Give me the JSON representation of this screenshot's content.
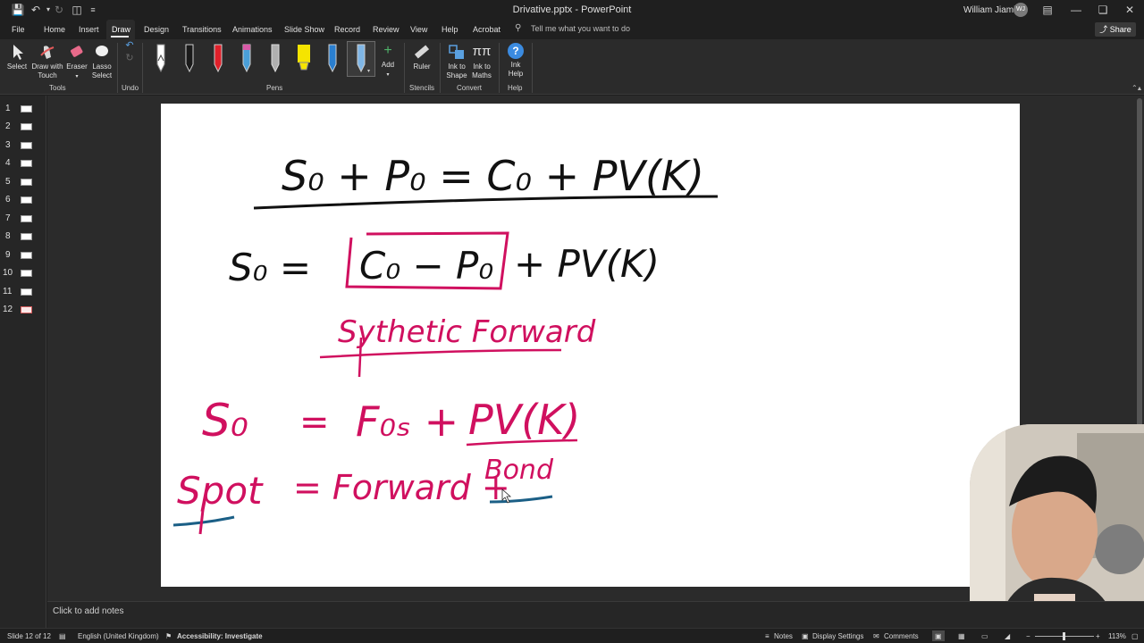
{
  "window": {
    "title": "Drivative.pptx - PowerPoint",
    "user_name": "William Jiamin",
    "user_initials": "WJ"
  },
  "ribbon_tabs": [
    {
      "label": "File"
    },
    {
      "label": "Home"
    },
    {
      "label": "Insert"
    },
    {
      "label": "Draw",
      "active": true
    },
    {
      "label": "Design"
    },
    {
      "label": "Transitions"
    },
    {
      "label": "Animations"
    },
    {
      "label": "Slide Show"
    },
    {
      "label": "Record"
    },
    {
      "label": "Review"
    },
    {
      "label": "View"
    },
    {
      "label": "Help"
    },
    {
      "label": "Acrobat"
    }
  ],
  "tell_me": "Tell me what you want to do",
  "share_label": "Share",
  "ribbon": {
    "tools": {
      "select": "Select",
      "draw_with_touch_1": "Draw with",
      "draw_with_touch_2": "Touch",
      "eraser": "Eraser",
      "lasso_1": "Lasso",
      "lasso_2": "Select",
      "group": "Tools"
    },
    "undo_group": "Undo",
    "pens_group": "Pens",
    "add_label": "Add",
    "ruler": "Ruler",
    "stencils_group": "Stencils",
    "ink_to_shape_1": "Ink to",
    "ink_to_shape_2": "Shape",
    "ink_to_maths_1": "Ink to",
    "ink_to_maths_2": "Maths",
    "convert_group": "Convert",
    "ink_help_1": "Ink",
    "ink_help_2": "Help",
    "help_group": "Help"
  },
  "pen_colors": [
    "#ffffff",
    "#1a1a1a",
    "#e0202a",
    "#4a9fd8",
    "#b0b0b0",
    "#f5e400",
    "#2a7fd0",
    "#7fb6e6"
  ],
  "slides": [
    {
      "num": "1"
    },
    {
      "num": "2"
    },
    {
      "num": "3"
    },
    {
      "num": "4"
    },
    {
      "num": "5"
    },
    {
      "num": "6"
    },
    {
      "num": "7"
    },
    {
      "num": "8"
    },
    {
      "num": "9"
    },
    {
      "num": "10"
    },
    {
      "num": "11"
    },
    {
      "num": "12",
      "selected": true
    }
  ],
  "ink": {
    "line1": "S₀ + P₀ = C₀ + PV(K)",
    "line2_left": "S₀ =",
    "line2_box": "C₀ − P₀",
    "line2_right": "+ PV(K)",
    "synthetic": "Sythetic Forward",
    "line3_left": "S₀",
    "line3_eq": "=",
    "line3_mid": "F₀ₛ +",
    "line3_right": "PV(K)",
    "line4_spot": "Spot",
    "line4_rest": "= Forward +",
    "line4_bond": "Bond"
  },
  "ink_colors": {
    "black": "#111111",
    "pink": "#d0105f",
    "teal": "#1b5f86"
  },
  "notes_placeholder": "Click to add notes",
  "status": {
    "slide": "Slide 12 of 12",
    "language": "English (United Kingdom)",
    "accessibility": "Accessibility: Investigate",
    "notes": "Notes",
    "display_settings": "Display Settings",
    "comments": "Comments",
    "zoom": "113%"
  }
}
